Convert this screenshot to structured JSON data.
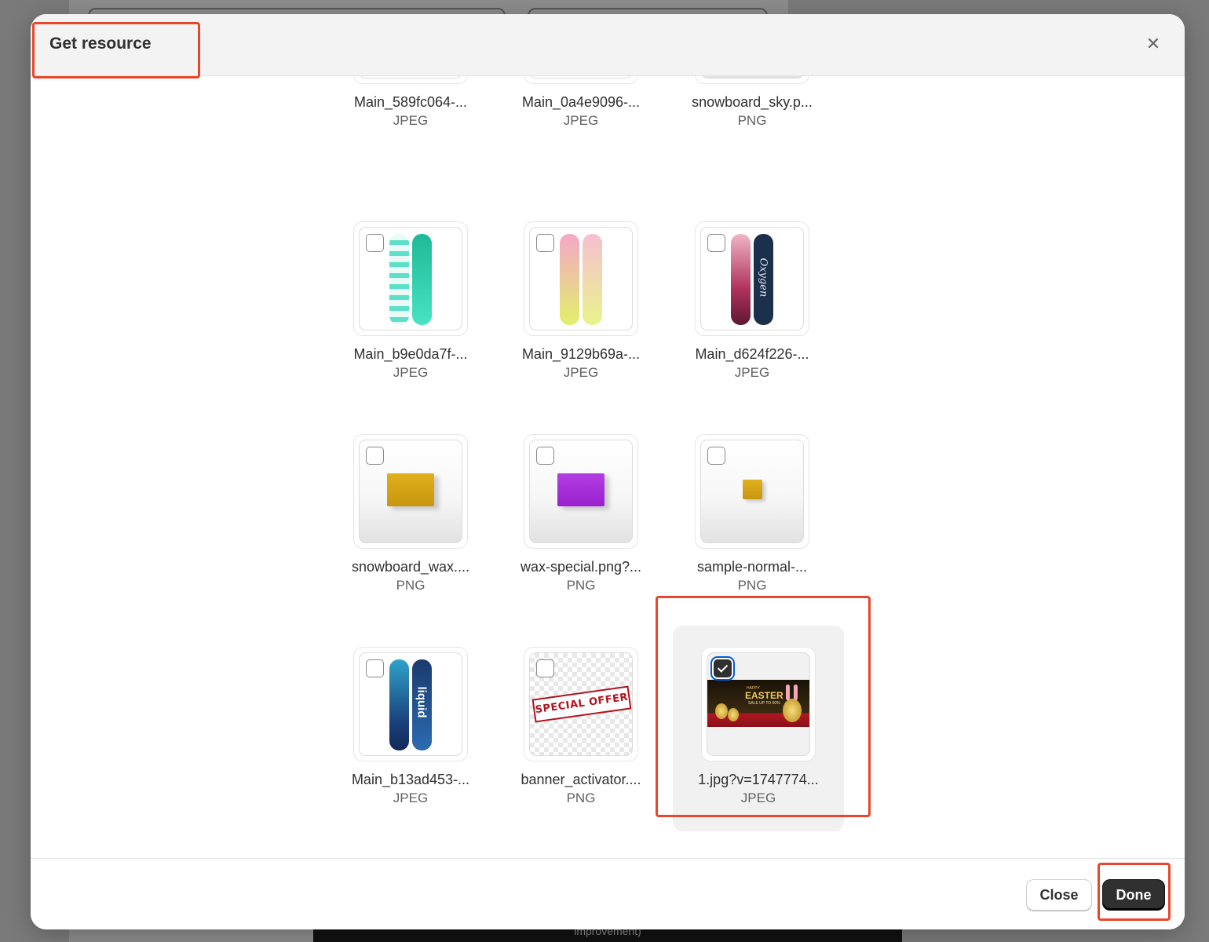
{
  "dialog": {
    "title": "Get resource",
    "close_icon": "close-icon"
  },
  "files": [
    {
      "name": "Main_589fc064-...",
      "type": "JPEG",
      "selected": false
    },
    {
      "name": "Main_0a4e9096-...",
      "type": "JPEG",
      "selected": false
    },
    {
      "name": "snowboard_sky.p...",
      "type": "PNG",
      "selected": false
    },
    {
      "name": "Main_b9e0da7f-...",
      "type": "JPEG",
      "selected": false
    },
    {
      "name": "Main_9129b69a-...",
      "type": "JPEG",
      "selected": false
    },
    {
      "name": "Main_d624f226-...",
      "type": "JPEG",
      "selected": false
    },
    {
      "name": "snowboard_wax....",
      "type": "PNG",
      "selected": false
    },
    {
      "name": "wax-special.png?...",
      "type": "PNG",
      "selected": false
    },
    {
      "name": "sample-normal-...",
      "type": "PNG",
      "selected": false
    },
    {
      "name": "Main_b13ad453-...",
      "type": "JPEG",
      "selected": false
    },
    {
      "name": "banner_activator....",
      "type": "PNG",
      "selected": false
    },
    {
      "name": "1.jpg?v=1747774...",
      "type": "JPEG",
      "selected": true
    }
  ],
  "thumb_text": {
    "board_oxygen": "Oxygen",
    "board_liquid": "liquid",
    "banner_special": "SPECIAL OFFER",
    "easter_happy": "HAPPY",
    "easter_title": "EASTER",
    "easter_sale": "SALE UP TO 50%"
  },
  "footer": {
    "close_label": "Close",
    "done_label": "Done"
  },
  "background": {
    "bottom_text": "improvement)"
  },
  "colors": {
    "primary_button": "#303030",
    "annotation": "#e8472b",
    "focus_ring": "#0059d8"
  }
}
